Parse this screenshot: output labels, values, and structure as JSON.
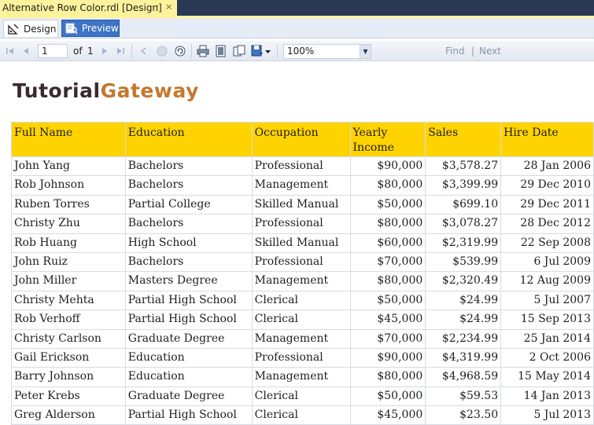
{
  "document_tab": {
    "title": "Alternative Row Color.rdl [Design]",
    "pin_glyph": "⊸",
    "close_glyph": "×"
  },
  "designer_tabs": [
    {
      "label": "Design",
      "icon": "design-icon",
      "active": true
    },
    {
      "label": "Preview",
      "icon": "preview-icon",
      "active": false
    }
  ],
  "toolbar": {
    "page_value": "1",
    "of_label": "of",
    "total_pages": "1",
    "zoom_value": "100%",
    "find_label": "Find",
    "separator": "|",
    "next_label": "Next"
  },
  "report": {
    "logo_part1": "Tutorial",
    "logo_part2": "Gateway",
    "header_color": "#ffd300",
    "columns": [
      "Full Name",
      "Education",
      "Occupation",
      "Yearly Income",
      "Sales",
      "Hire Date"
    ],
    "rows": [
      [
        "John Yang",
        "Bachelors",
        "Professional",
        "$90,000",
        "$3,578.27",
        "28 Jan 2006"
      ],
      [
        "Rob Johnson",
        "Bachelors",
        "Management",
        "$80,000",
        "$3,399.99",
        "29 Dec 2010"
      ],
      [
        "Ruben Torres",
        "Partial College",
        "Skilled Manual",
        "$50,000",
        "$699.10",
        "29 Dec 2011"
      ],
      [
        "Christy Zhu",
        "Bachelors",
        "Professional",
        "$80,000",
        "$3,078.27",
        "28 Dec 2012"
      ],
      [
        "Rob Huang",
        "High School",
        "Skilled Manual",
        "$60,000",
        "$2,319.99",
        "22 Sep 2008"
      ],
      [
        "John Ruiz",
        "Bachelors",
        "Professional",
        "$70,000",
        "$539.99",
        "6 Jul 2009"
      ],
      [
        "John Miller",
        "Masters Degree",
        "Management",
        "$80,000",
        "$2,320.49",
        "12 Aug 2009"
      ],
      [
        "Christy Mehta",
        "Partial High School",
        "Clerical",
        "$50,000",
        "$24.99",
        "5 Jul 2007"
      ],
      [
        "Rob Verhoff",
        "Partial High School",
        "Clerical",
        "$45,000",
        "$24.99",
        "15 Sep 2013"
      ],
      [
        "Christy Carlson",
        "Graduate Degree",
        "Management",
        "$70,000",
        "$2,234.99",
        "25 Jan 2014"
      ],
      [
        "Gail Erickson",
        "Education",
        "Professional",
        "$90,000",
        "$4,319.99",
        "2 Oct 2006"
      ],
      [
        "Barry Johnson",
        "Education",
        "Management",
        "$80,000",
        "$4,968.59",
        "15 May 2014"
      ],
      [
        "Peter Krebs",
        "Graduate Degree",
        "Clerical",
        "$50,000",
        "$59.53",
        "14 Jan 2013"
      ],
      [
        "Greg Alderson",
        "Partial High School",
        "Clerical",
        "$45,000",
        "$23.50",
        "5 Jul 2013"
      ]
    ]
  }
}
